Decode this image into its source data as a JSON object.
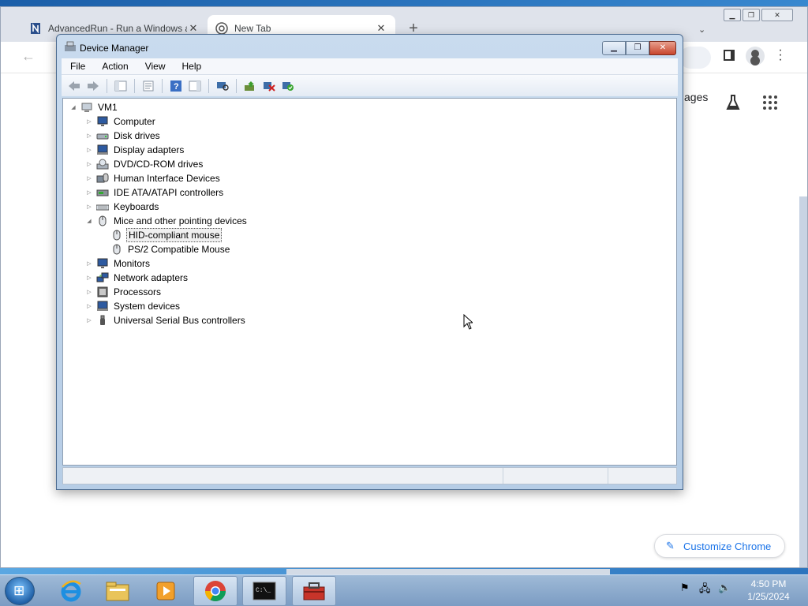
{
  "chrome": {
    "tabs": [
      {
        "title": "AdvancedRun - Run a Windows application with different settings",
        "icon": "advancedrun-icon"
      },
      {
        "title": "New Tab",
        "icon": "chrome-icon"
      }
    ],
    "images_link": "ages",
    "customize_label": "Customize Chrome"
  },
  "device_manager": {
    "title": "Device Manager",
    "menu": [
      "File",
      "Action",
      "View",
      "Help"
    ],
    "toolbar_icons": [
      "back-icon",
      "forward-icon",
      "show-hide-console-tree-icon",
      "properties-icon",
      "help-icon",
      "action-pane-icon",
      "scan-hardware-icon",
      "update-driver-icon",
      "uninstall-icon",
      "enable-device-icon"
    ],
    "tree": {
      "root": "VM1",
      "items": [
        {
          "label": "Computer",
          "expanded": false
        },
        {
          "label": "Disk drives",
          "expanded": false
        },
        {
          "label": "Display adapters",
          "expanded": false
        },
        {
          "label": "DVD/CD-ROM drives",
          "expanded": false
        },
        {
          "label": "Human Interface Devices",
          "expanded": false
        },
        {
          "label": "IDE ATA/ATAPI controllers",
          "expanded": false
        },
        {
          "label": "Keyboards",
          "expanded": false
        },
        {
          "label": "Mice and other pointing devices",
          "expanded": true,
          "children": [
            {
              "label": "HID-compliant mouse",
              "selected": true
            },
            {
              "label": "PS/2 Compatible Mouse",
              "selected": false
            }
          ]
        },
        {
          "label": "Monitors",
          "expanded": false
        },
        {
          "label": "Network adapters",
          "expanded": false
        },
        {
          "label": "Processors",
          "expanded": false
        },
        {
          "label": "System devices",
          "expanded": false
        },
        {
          "label": "Universal Serial Bus controllers",
          "expanded": false
        }
      ]
    }
  },
  "taskbar": {
    "apps": [
      "internet-explorer-icon",
      "file-explorer-icon",
      "media-player-icon",
      "chrome-icon",
      "command-prompt-icon",
      "toolbox-icon"
    ],
    "time": "4:50 PM",
    "date": "1/25/2024"
  }
}
